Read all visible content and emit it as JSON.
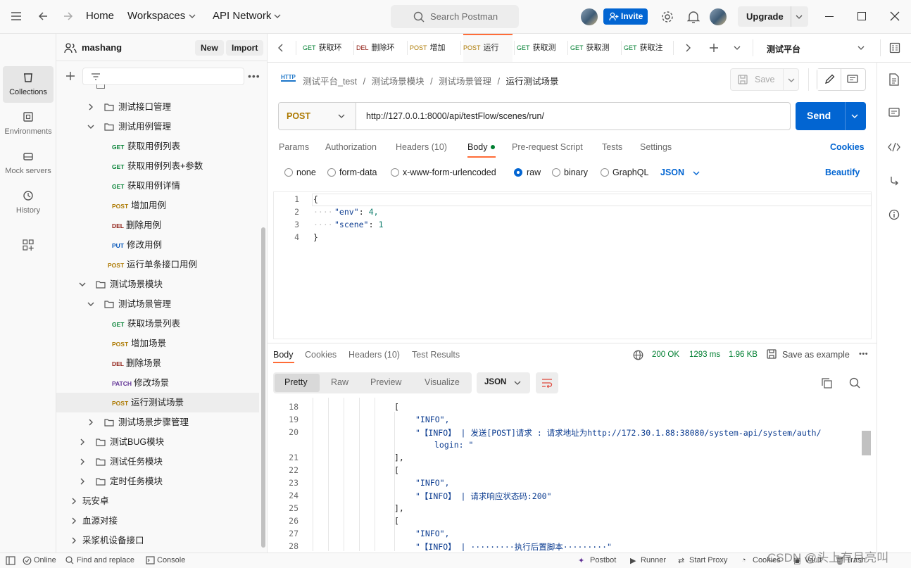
{
  "topbar": {
    "home": "Home",
    "workspaces": "Workspaces",
    "api_network": "API Network",
    "search_placeholder": "Search Postman",
    "invite": "Invite",
    "upgrade": "Upgrade"
  },
  "workspace": {
    "name": "mashang",
    "new": "New",
    "import": "Import"
  },
  "rail": [
    {
      "label": "Collections",
      "icon": "collections-icon"
    },
    {
      "label": "Environments",
      "icon": "environments-icon"
    },
    {
      "label": "Mock servers",
      "icon": "mock-servers-icon"
    },
    {
      "label": "History",
      "icon": "history-icon"
    }
  ],
  "tree": [
    {
      "label": "测试接口管理",
      "kind": "folder",
      "depth": 2,
      "open": false
    },
    {
      "label": "测试用例管理",
      "kind": "folder",
      "depth": 2,
      "open": true
    },
    {
      "label": "获取用例列表",
      "kind": "req",
      "method": "GET",
      "depth": 3
    },
    {
      "label": "获取用例列表+参数",
      "kind": "req",
      "method": "GET",
      "depth": 3
    },
    {
      "label": "获取用例详情",
      "kind": "req",
      "method": "GET",
      "depth": 3
    },
    {
      "label": "增加用例",
      "kind": "req",
      "method": "POST",
      "depth": 3
    },
    {
      "label": "删除用例",
      "kind": "req",
      "method": "DEL",
      "depth": 3
    },
    {
      "label": "修改用例",
      "kind": "req",
      "method": "PUT",
      "depth": 3
    },
    {
      "label": "运行单条接口用例",
      "kind": "req",
      "method": "POST",
      "depth": 2.4
    },
    {
      "label": "测试场景模块",
      "kind": "folder",
      "depth": 1,
      "open": true
    },
    {
      "label": "测试场景管理",
      "kind": "folder",
      "depth": 2,
      "open": true
    },
    {
      "label": "获取场景列表",
      "kind": "req",
      "method": "GET",
      "depth": 3
    },
    {
      "label": "增加场景",
      "kind": "req",
      "method": "POST",
      "depth": 3
    },
    {
      "label": "删除场景",
      "kind": "req",
      "method": "DEL",
      "depth": 3
    },
    {
      "label": "修改场景",
      "kind": "req",
      "method": "PATCH",
      "depth": 3
    },
    {
      "label": "运行测试场景",
      "kind": "req",
      "method": "POST",
      "depth": 3,
      "active": true
    },
    {
      "label": "测试场景步骤管理",
      "kind": "folder",
      "depth": 2,
      "open": false
    },
    {
      "label": "测试BUG模块",
      "kind": "folder",
      "depth": 1,
      "open": false
    },
    {
      "label": "测试任务模块",
      "kind": "folder",
      "depth": 1,
      "open": false
    },
    {
      "label": "定时任务模块",
      "kind": "folder",
      "depth": 1,
      "open": false
    },
    {
      "label": "玩安卓",
      "kind": "collection",
      "depth": 0
    },
    {
      "label": "血源对接",
      "kind": "collection",
      "depth": 0
    },
    {
      "label": "采浆机设备接口",
      "kind": "collection",
      "depth": 0
    }
  ],
  "tabs": [
    {
      "method": "GET",
      "label": "获取环"
    },
    {
      "method": "DEL",
      "label": "删除环"
    },
    {
      "method": "POST",
      "label": "增加"
    },
    {
      "method": "POST",
      "label": "运行",
      "active": true
    },
    {
      "method": "GET",
      "label": "获取测"
    },
    {
      "method": "GET",
      "label": "获取测"
    },
    {
      "method": "GET",
      "label": "获取注"
    }
  ],
  "environment": "测试平台",
  "breadcrumb": [
    "测试平台_test",
    "测试场景模块",
    "测试场景管理",
    "运行测试场景"
  ],
  "http_badge": "HTTP",
  "save": "Save",
  "request": {
    "method": "POST",
    "url": "http://127.0.0.1:8000/api/testFlow/scenes/run/",
    "send": "Send"
  },
  "req_tabs": [
    "Params",
    "Authorization",
    "Headers (10)",
    "Body",
    "Pre-request Script",
    "Tests",
    "Settings"
  ],
  "cookies": "Cookies",
  "body_modes": [
    "none",
    "form-data",
    "x-www-form-urlencoded",
    "raw",
    "binary",
    "GraphQL"
  ],
  "body_lang": "JSON",
  "beautify": "Beautify",
  "request_body": [
    {
      "n": "1",
      "text": "{"
    },
    {
      "n": "2",
      "key": "\"env\"",
      "val": "4,"
    },
    {
      "n": "3",
      "key": "\"scene\"",
      "val": "1"
    },
    {
      "n": "4",
      "text": "}"
    }
  ],
  "resp_tabs": [
    "Body",
    "Cookies",
    "Headers (10)",
    "Test Results"
  ],
  "resp_status": {
    "code": "200 OK",
    "time": "1293 ms",
    "size": "1.96 KB",
    "save_example": "Save as example"
  },
  "view_modes": [
    "Pretty",
    "Raw",
    "Preview",
    "Visualize"
  ],
  "resp_lang": "JSON",
  "response_lines": [
    {
      "n": "18",
      "text": "[",
      "indent": 0
    },
    {
      "n": "19",
      "text": "\"INFO\",",
      "indent": 1
    },
    {
      "n": "20",
      "text": "\"【INFO】  |   发送[POST]请求 : 请求地址为http://172.30.1.88:38080/system-api/system/auth/",
      "indent": 1,
      "wrap": "login: \""
    },
    {
      "n": "21",
      "text": "],",
      "indent": 0
    },
    {
      "n": "22",
      "text": "[",
      "indent": 0
    },
    {
      "n": "23",
      "text": "\"INFO\",",
      "indent": 1
    },
    {
      "n": "24",
      "text": "\"【INFO】  |   请求响应状态码:200\"",
      "indent": 1
    },
    {
      "n": "25",
      "text": "],",
      "indent": 0
    },
    {
      "n": "26",
      "text": "[",
      "indent": 0
    },
    {
      "n": "27",
      "text": "\"INFO\",",
      "indent": 1
    },
    {
      "n": "28",
      "text": "\"【INFO】  |   ·········执行后置脚本·········\"",
      "indent": 1
    }
  ],
  "statusbar": {
    "online": "Online",
    "find": "Find and replace",
    "console": "Console",
    "postbot": "Postbot",
    "runner": "Runner",
    "proxy": "Start Proxy",
    "cookies": "Cookies",
    "vault": "Vault",
    "trash": "Trash"
  },
  "watermark": "CSDN @头上有月亮叫",
  "colors": {
    "accent": "#0265d2",
    "get": "#007f31",
    "post": "#ad7a03",
    "del": "#8e1a10",
    "put": "#0053b8",
    "patch": "#623497",
    "active_tab": "#ff6c37"
  }
}
